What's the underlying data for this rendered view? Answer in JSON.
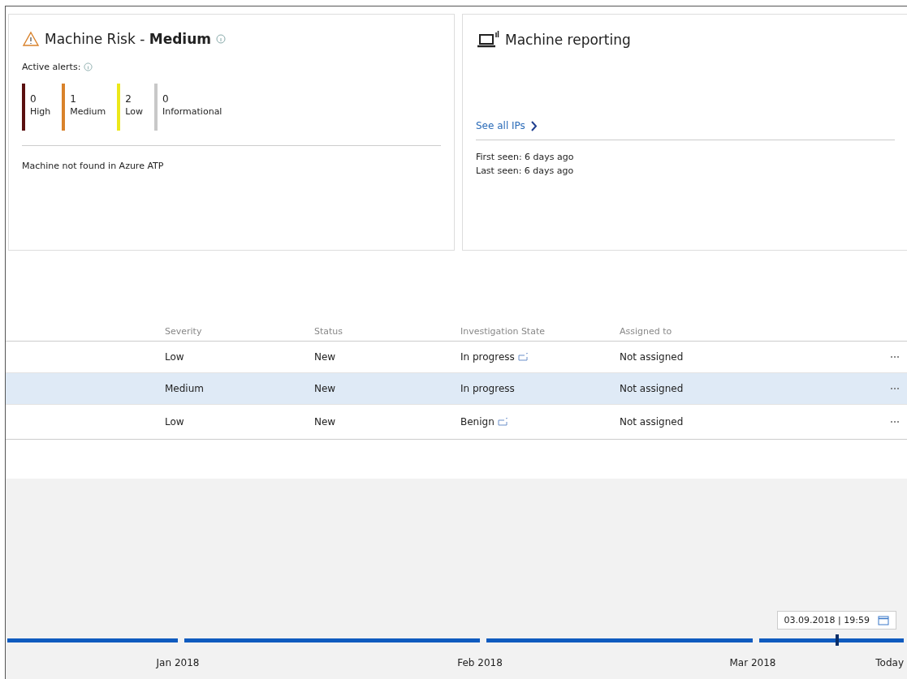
{
  "risk_card": {
    "title": "Machine Risk - ",
    "level_text": "Medium",
    "active_alerts_label": "Active alerts:",
    "alert_counts": [
      {
        "count": "0",
        "label": "High",
        "color": "#5a0f0f"
      },
      {
        "count": "1",
        "label": "Medium",
        "color": "#d9822b"
      },
      {
        "count": "2",
        "label": "Low",
        "color": "#ece81a"
      },
      {
        "count": "0",
        "label": "Informational",
        "color": "#c8c8c8"
      }
    ],
    "note": "Machine not found in Azure ATP"
  },
  "reporting_card": {
    "title": "Machine reporting",
    "link": "See all IPs",
    "first_seen": "First seen: 6 days ago",
    "last_seen": "Last seen: 6 days ago"
  },
  "table": {
    "columns": [
      "Severity",
      "Status",
      "Investigation State",
      "Assigned to"
    ],
    "rows": [
      {
        "severity": "Low",
        "status": "New",
        "investigation_state": "In progress",
        "state_icon": true,
        "assigned_to": "Not assigned",
        "selected": false
      },
      {
        "severity": "Medium",
        "status": "New",
        "investigation_state": "In progress",
        "state_icon": false,
        "assigned_to": "Not assigned",
        "selected": true
      },
      {
        "severity": "Low",
        "status": "New",
        "investigation_state": "Benign",
        "state_icon": true,
        "assigned_to": "Not assigned",
        "selected": false
      }
    ]
  },
  "timeline": {
    "date_field": "03.09.2018 | 19:59",
    "level": 0.92,
    "months": [
      "Jan 2018",
      "Feb 2018",
      "Mar 2018",
      "Today"
    ]
  }
}
